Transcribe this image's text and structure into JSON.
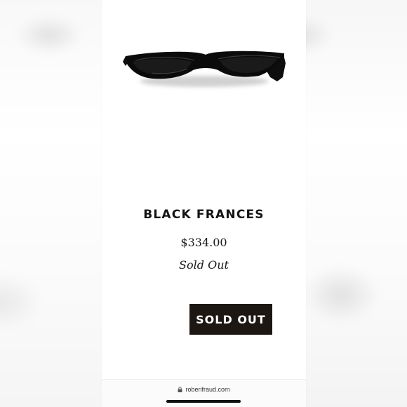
{
  "product": {
    "title": "BLACK FRANCES",
    "price": "$334.00",
    "availability": "Sold Out",
    "image_icon": "sunglasses"
  },
  "actions": {
    "sold_out_label": "SOLD OUT"
  },
  "browser": {
    "url": "roberifraud.com",
    "lock_icon": "lock"
  },
  "colors": {
    "button_bg": "#1c1713",
    "button_text": "#ffffff",
    "text": "#141414",
    "page_bg": "#ffffff"
  }
}
